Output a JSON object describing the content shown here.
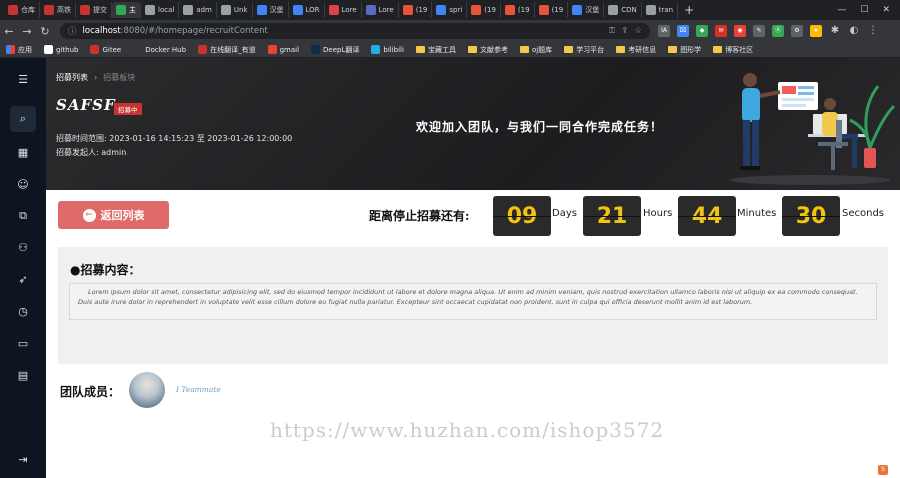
{
  "browser": {
    "tabs": [
      {
        "label": "仓库",
        "color": "#c8322f"
      },
      {
        "label": "高铁",
        "color": "#c8322f"
      },
      {
        "label": "提交",
        "color": "#c8322f"
      },
      {
        "label": "主",
        "color": "#34a853"
      },
      {
        "label": "local",
        "color": "#9aa0a6"
      },
      {
        "label": "adm",
        "color": "#9aa0a6"
      },
      {
        "label": "Unk",
        "color": "#9aa0a6"
      },
      {
        "label": "汉堡",
        "color": "#4285f4"
      },
      {
        "label": "LOR",
        "color": "#4285f4"
      },
      {
        "label": "Lore",
        "color": "#e04343"
      },
      {
        "label": "Lore",
        "color": "#5c6bc0"
      },
      {
        "label": "(19",
        "color": "#e8543a"
      },
      {
        "label": "spri",
        "color": "#4285f4"
      },
      {
        "label": "(19",
        "color": "#e8543a"
      },
      {
        "label": "(19",
        "color": "#e8543a"
      },
      {
        "label": "(19",
        "color": "#e8543a"
      },
      {
        "label": "汉堡",
        "color": "#4285f4"
      },
      {
        "label": "CDN",
        "color": "#9aa0a6"
      },
      {
        "label": "tran",
        "color": "#9aa0a6"
      }
    ],
    "url_host": "localhost",
    "url_path": ":8080/#/homepage/recruitContent",
    "bookmarks": [
      {
        "label": "应用",
        "type": "apps"
      },
      {
        "label": "github",
        "type": "site",
        "color": "#ffffff"
      },
      {
        "label": "Gitee",
        "type": "site",
        "color": "#c8322f"
      },
      {
        "label": "Docker Hub",
        "type": "site",
        "color": "#35363a"
      },
      {
        "label": "在线翻译_有道",
        "type": "site",
        "color": "#c8322f"
      },
      {
        "label": "gmail",
        "type": "site",
        "color": "#ea4335"
      },
      {
        "label": "DeepL翻译",
        "type": "site",
        "color": "#0f2b46"
      },
      {
        "label": "bilibili",
        "type": "site",
        "color": "#23ade5"
      },
      {
        "label": "宝藏工具",
        "type": "folder"
      },
      {
        "label": "文献参考",
        "type": "folder"
      },
      {
        "label": "oj题库",
        "type": "folder"
      },
      {
        "label": "学习平台",
        "type": "folder"
      },
      {
        "label": "考研信息",
        "type": "folder"
      },
      {
        "label": "图形学",
        "type": "folder"
      },
      {
        "label": "博客社区",
        "type": "folder"
      }
    ]
  },
  "sidebar": {
    "icons": [
      "menu-icon",
      "search-icon",
      "dashboard-icon",
      "user-icon",
      "chat-icon",
      "team-icon",
      "rocket-icon",
      "history-icon",
      "message-icon",
      "document-icon",
      "logout-icon"
    ]
  },
  "banner": {
    "breadcrumb_parent": "招募列表",
    "breadcrumb_current": "招募板块",
    "title": "SAFSF",
    "status": "招募中",
    "time_range": "招募时间范围: 2023-01-16 14:15:23 至 2023-01-26 12:00:00",
    "initiator": "招募发起人: admin",
    "slogan": "欢迎加入团队，与我们一同合作完成任务！"
  },
  "content": {
    "back_label": "返回列表",
    "countdown_label": "距离停止招募还有:",
    "countdown": {
      "days": "09",
      "days_label": "Days",
      "hours": "21",
      "hours_label": "Hours",
      "minutes": "44",
      "minutes_label": "Minutes",
      "seconds": "30",
      "seconds_label": "Seconds"
    },
    "recruit_heading": "●招募内容：",
    "recruit_body": "Lorem ipsum dolor sit amet, consectetur adipisicing elit, sed do eiusmod tempor incididunt ut labore et dolore magna aliqua. Ut enim ad minim veniam, quis nostrud exercitation ullamco laboris nisi ut aliquip ex ea commodo consequat. Duis aute irure dolor in reprehendert in voluptate velit esse cillum dolore eu fugiat nulla pariatur. Excepteur sint occaecat cupidatat non proident, sunt in culpa qui officia deserunt mollit anim id est laborum.",
    "team_label": "团队成员：",
    "member_name": "I Teammate"
  },
  "watermark": "https://www.huzhan.com/ishop3572"
}
